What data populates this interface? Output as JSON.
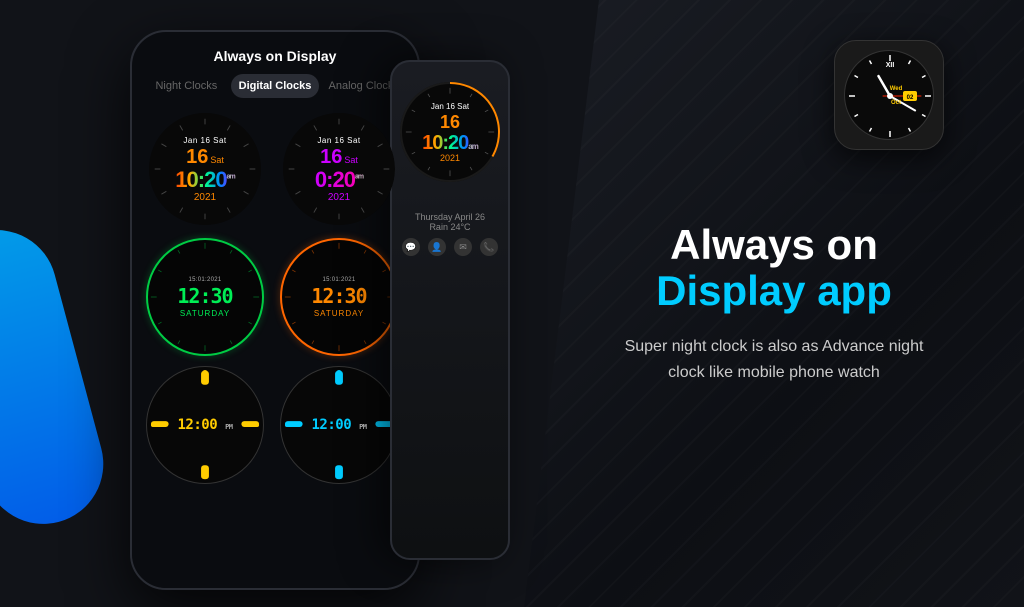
{
  "app": {
    "background_color": "#111318"
  },
  "phone1": {
    "header": "Always on Display",
    "tabs": [
      {
        "label": "Night Clocks",
        "active": false
      },
      {
        "label": "Digital Clocks",
        "active": true
      },
      {
        "label": "Analog Clocks",
        "active": false
      }
    ],
    "clocks": [
      {
        "type": "rainbow",
        "date_label": "Jan 16 Sat",
        "day": "16",
        "day_name": "Sat",
        "time": "10:20",
        "ampm": "am",
        "year": "2021"
      },
      {
        "type": "magenta",
        "date_label": "Jan 16 Sat",
        "day": "16",
        "day_name": "Sat",
        "time": "0:20",
        "ampm": "am",
        "year": "2021"
      },
      {
        "type": "digital-green",
        "small_text": "15:01:2021",
        "time": "12:30",
        "day_label": "SATURDAY"
      },
      {
        "type": "digital-orange",
        "small_text": "15:01:2021",
        "time": "12:30",
        "day_label": "SATURDAY"
      },
      {
        "type": "minimal-yellow",
        "time": "12:00",
        "ampm": "PM"
      },
      {
        "type": "minimal-cyan",
        "time": "12:00",
        "ampm": "PM"
      }
    ]
  },
  "phone2": {
    "clock": {
      "date_label": "Jan 16 Sat",
      "day": "16",
      "time": "10:20",
      "ampm": "am",
      "year": "2021"
    },
    "weather": {
      "line1": "Thursday April 26",
      "line2": "Rain 24°C"
    }
  },
  "watch_preview": {
    "day": "Wed",
    "date": "02",
    "month": "Oct"
  },
  "right_text": {
    "headline_white": "Always on",
    "headline_cyan": "Display app",
    "subtext": "Super night clock is also as Advance night clock like mobile phone watch"
  }
}
